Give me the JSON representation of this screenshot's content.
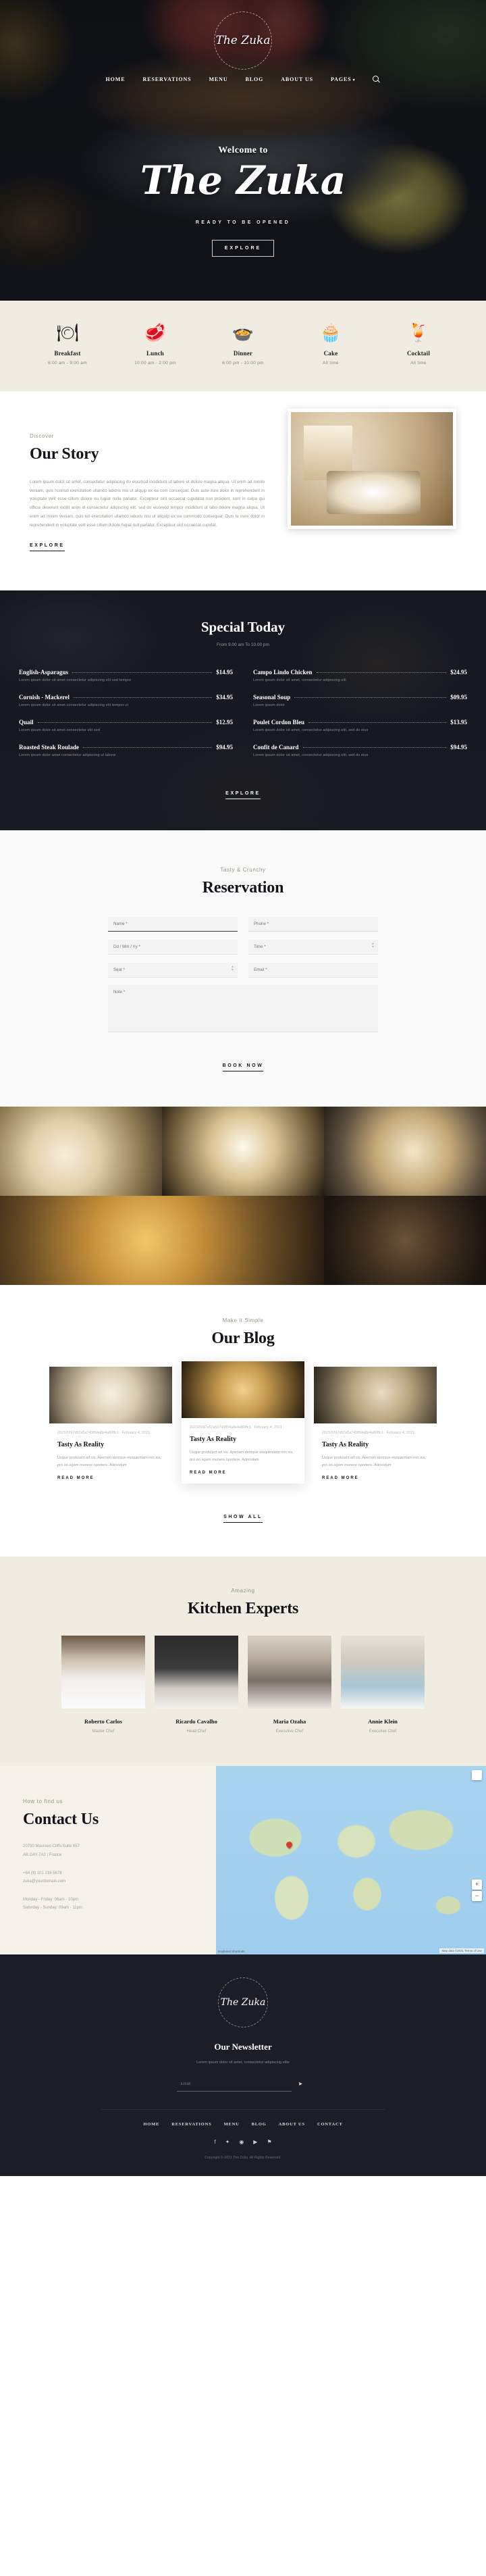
{
  "brand": {
    "name": "The Zuka"
  },
  "nav": {
    "items": [
      {
        "label": "HOME",
        "name": "nav-home"
      },
      {
        "label": "RESERVATIONS",
        "name": "nav-reservations"
      },
      {
        "label": "MENU",
        "name": "nav-menu"
      },
      {
        "label": "BLOG",
        "name": "nav-blog"
      },
      {
        "label": "ABOUT US",
        "name": "nav-about-us"
      },
      {
        "label": "PAGES",
        "name": "nav-pages",
        "caret": "▾"
      }
    ],
    "search_icon": "search-icon"
  },
  "hero": {
    "welcome": "Welcome to",
    "title": "The Zuka",
    "tagline": "READY TO BE OPENED",
    "cta": "EXPLORE"
  },
  "meals": [
    {
      "icon": "🍽",
      "name": "Breakfast",
      "time": "6:00 am - 9:00 am"
    },
    {
      "icon": "🥩",
      "name": "Lunch",
      "time": "10:00 am - 2:00 pm"
    },
    {
      "icon": "🍲",
      "name": "Dinner",
      "time": "6:00 pm - 10:00 pm"
    },
    {
      "icon": "🧁",
      "name": "Cake",
      "time": "All time"
    },
    {
      "icon": "🍹",
      "name": "Cocktail",
      "time": "All time"
    }
  ],
  "story": {
    "eyebrow": "Discover",
    "title": "Our Story",
    "text": "Lorem ipsum dolor sit amet, consectetur adipiscing do eiusmod incididunt ut labore et dolore magna aliqua. Ut enim ad minim veniam, quis nostrud exercitation ullamco laboris nisi ut aliquip ex ea com consequat. Duis aute irure dolor in reprehenderit in voluptate velit esse cillum dolore eu fugiat nulla pariatur. Excepteur sint occaecat cupidatat non proident, sunt in culpa qui officia deserunt mollit anim id consectetur adipiscing elit, sed do eiusmod tempor incididunt ut labo dolore magna aliqua. Ut enim ad minim veniam, quis ud exercitation ullamco laboris nisi ut aliquip ex ea commodo consequat. Duis te irure dolor in reprehenderit in voluptate velit esse cillum dolore fugiat null pariatur. Excepteur sint occaecat cupidat.",
    "cta": "EXPLORE"
  },
  "special": {
    "title": "Special Today",
    "subtitle": "From 9.00 am To 10.00 pm",
    "cta": "EXPLORE",
    "items": [
      {
        "name": "English-Asparagus",
        "price": "$14.95",
        "desc": "Lorem ipsum dolor sit amet consectetur adipiscing elit sed tempor"
      },
      {
        "name": "Campo Lindo Chicken",
        "price": "$24.95",
        "desc": "Lorem ipsum dolor sit amet, consectetur adipiscing elit"
      },
      {
        "name": "Cornish - Mackerel",
        "price": "$34.95",
        "desc": "Lorem ipsum dolor sit amet consectetur adipiscing elit tempor ut"
      },
      {
        "name": "Seasonal Soup",
        "price": "$09.95",
        "desc": "Lorem ipsum dolor"
      },
      {
        "name": "Quail",
        "price": "$12.95",
        "desc": "Lorem ipsum dolor sit amet consectetur elit sed"
      },
      {
        "name": "Poulet Cordon Bleu",
        "price": "$13.95",
        "desc": "Lorem ipsum dolor sit amet, consectetur adipiscing elit, sed do eius"
      },
      {
        "name": "Roasted Steak Roulade",
        "price": "$94.95",
        "desc": "Lorem ipsum dolor amet consectetur adipiscing ut labore"
      },
      {
        "name": "Confit de Canard",
        "price": "$94.95",
        "desc": "Lorem ipsum dolor sit amet, consectetur adipiscing elit, sed do eius"
      }
    ]
  },
  "reservation": {
    "eyebrow": "Tasty & Crunchy",
    "title": "Reservation",
    "fields": {
      "name": "Name *",
      "phone": "Phone *",
      "date": "Dd / Mm / Yy *",
      "time": "Time *",
      "seat": "Seat *",
      "email": "Email *",
      "note": "Note *"
    },
    "submit": "BOOK NOW"
  },
  "blog": {
    "eyebrow": "Make it Simple",
    "title": "Our Blog",
    "show_all": "SHOW ALL",
    "posts": [
      {
        "meta_id": "20232f297a57a5a743894a8e4a80ffc3",
        "date": "February 4, 2021",
        "title": "Tasty As Reality",
        "excerpt": "Usque postulant ad vis. Aperiam denique eloquentiam nec ea, pro an agam munere oportere. Admodum",
        "cta": "READ MORE"
      },
      {
        "meta_id": "20232f297a57a5a743894a8e4a80ffc3",
        "date": "February 4, 2021",
        "title": "Tasty As Reality",
        "excerpt": "Usque postulant ad vis. Aperiam denique eloquentiam nec ea, pro an agam munere oportere. Admodum",
        "cta": "READ MORE"
      },
      {
        "meta_id": "20232f297a57a5a743894a8e4a80ffc3",
        "date": "February 4, 2021",
        "title": "Tasty As Reality",
        "excerpt": "Usque postulant ad vis. Aperiam denique eloquentiam nec ea, pro an agam munere oportere. Admodum",
        "cta": "READ MORE"
      }
    ]
  },
  "chefs": {
    "eyebrow": "Amazing",
    "title": "Kitchen Experts",
    "members": [
      {
        "name": "Roberto Carlos",
        "role": "Master Chef"
      },
      {
        "name": "Ricardo Cavalho",
        "role": "Head Chef"
      },
      {
        "name": "Maria Ozaha",
        "role": "Executive Chef"
      },
      {
        "name": "Annie Klein",
        "role": "Executive Chef"
      }
    ]
  },
  "contact": {
    "eyebrow": "How to find us",
    "title": "Contact Us",
    "address_line1": "20700 Maureen Cliffs Suite 657",
    "address_line2": "AB G4Y-7A2 | France",
    "phone": "+84 (9) 101 234 5678",
    "email": "zuka@yourdomain.com",
    "hours_weekday": "Monday - Friday: 06am - 10pm",
    "hours_weekend": "Saturday - Sunday: 09am - 11pm",
    "map": {
      "zoom_in": "+",
      "zoom_out": "−",
      "attribution": "Map data ©2021  Terms of Use",
      "tag": "Keyboard shortcuts"
    }
  },
  "footer": {
    "brand": "The Zuka",
    "newsletter_title": "Our Newsletter",
    "newsletter_sub": "Lorem ipsum dolor sit amet, consectetur adipiscing elite",
    "email_placeholder": "Email",
    "send_icon": "➤",
    "nav": [
      {
        "label": "HOME"
      },
      {
        "label": "RESERVATIONS"
      },
      {
        "label": "MENU"
      },
      {
        "label": "BLOG"
      },
      {
        "label": "ABOUT US"
      },
      {
        "label": "CONTACT"
      }
    ],
    "socials": [
      {
        "icon": "f",
        "name": "facebook-icon"
      },
      {
        "icon": "✦",
        "name": "twitter-icon"
      },
      {
        "icon": "◉",
        "name": "instagram-icon"
      },
      {
        "icon": "▶",
        "name": "youtube-icon"
      },
      {
        "icon": "⚑",
        "name": "pinterest-icon"
      }
    ],
    "copyright": "Copyright © 2021 The Zuka. All Rights Reserved."
  }
}
